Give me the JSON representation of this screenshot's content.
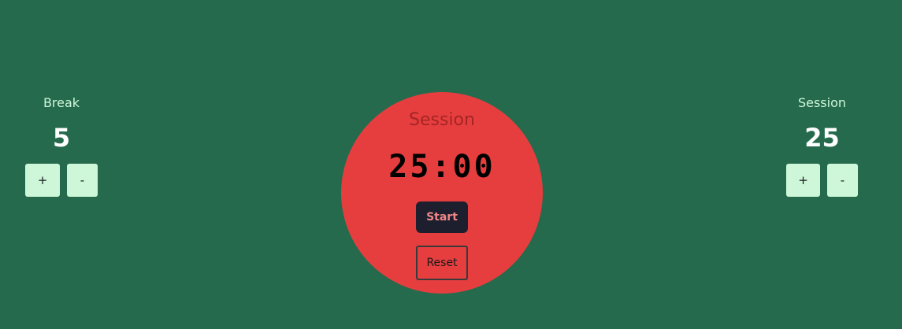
{
  "break": {
    "label": "Break",
    "value": "5",
    "increment_label": "+",
    "decrement_label": "-"
  },
  "session": {
    "label": "Session",
    "value": "25",
    "increment_label": "+",
    "decrement_label": "-"
  },
  "timer": {
    "mode_label": "Session",
    "time": "25:00",
    "start_label": "Start",
    "reset_label": "Reset"
  },
  "colors": {
    "background": "#256a4d",
    "circle": "#e63e3e",
    "stepper_button": "#cdf7d8",
    "start_button": "#1e1f2e"
  }
}
